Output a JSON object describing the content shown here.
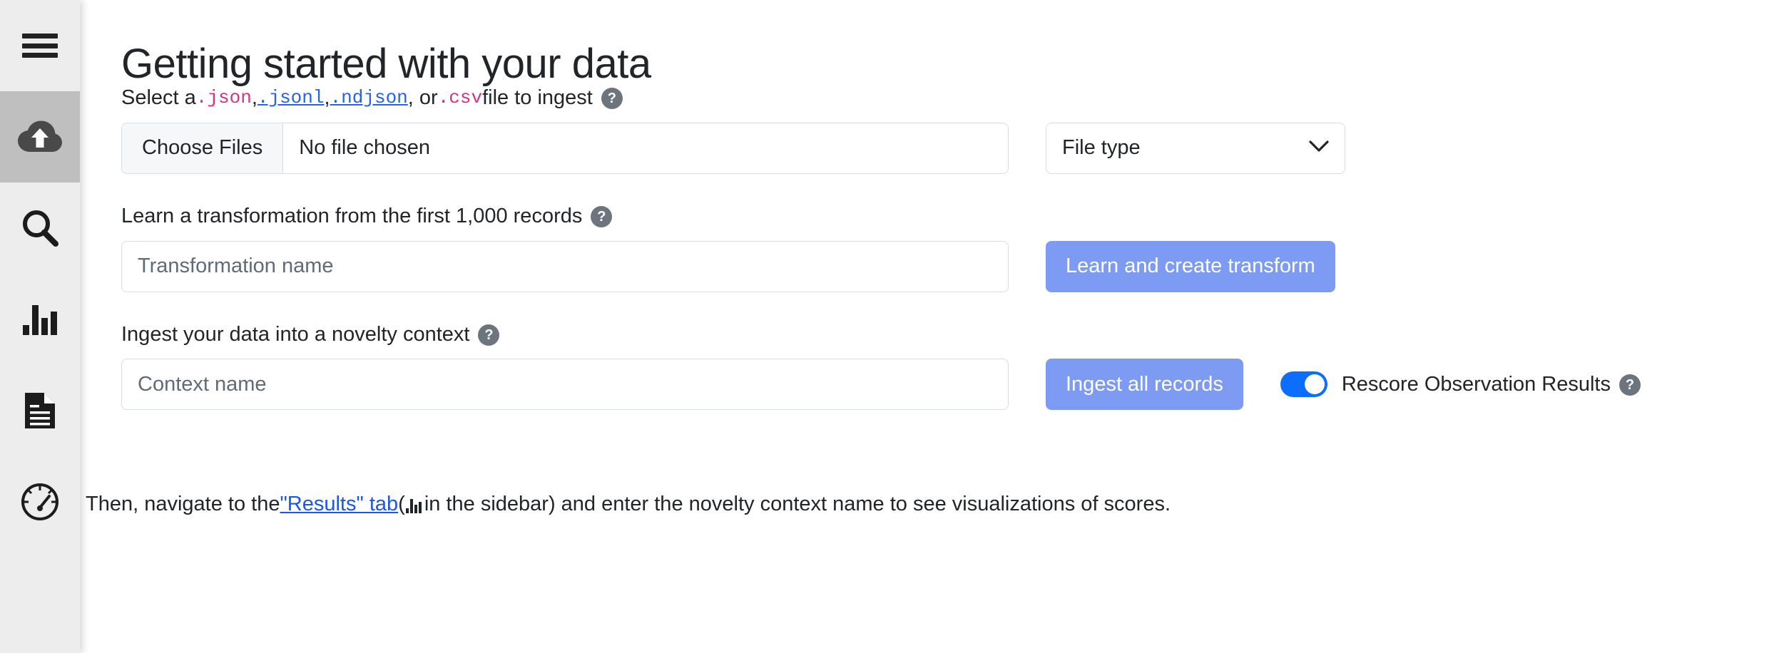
{
  "sidebar": {
    "items": [
      {
        "name": "menu",
        "icon": "hamburger-menu-icon",
        "selected": false
      },
      {
        "name": "ingest",
        "icon": "cloud-upload-icon",
        "selected": true
      },
      {
        "name": "search",
        "icon": "magnifier-icon",
        "selected": false
      },
      {
        "name": "results",
        "icon": "bar-chart-icon",
        "selected": false
      },
      {
        "name": "documents",
        "icon": "document-icon",
        "selected": false
      },
      {
        "name": "monitor",
        "icon": "gauge-icon",
        "selected": false
      }
    ]
  },
  "page": {
    "title": "Getting started with your data"
  },
  "file_section": {
    "label_prefix": "Select a ",
    "ext_json": ".json",
    "sep1": ", ",
    "ext_jsonl": ".jsonl",
    "sep2": ", ",
    "ext_ndjson": ".ndjson",
    "sep3": ", or ",
    "ext_csv": ".csv",
    "label_suffix": " file to ingest",
    "help": "?",
    "choose_files_label": "Choose Files",
    "file_chosen_text": "No file chosen",
    "file_type_value": "File type",
    "chevron": "chevron-down"
  },
  "transform_section": {
    "label": "Learn a transformation from the first 1,000 records",
    "help": "?",
    "input_placeholder": "Transformation name",
    "input_value": "",
    "button_label": "Learn and create transform"
  },
  "ingest_section": {
    "label": "Ingest your data into a novelty context",
    "help": "?",
    "input_placeholder": "Context name",
    "input_value": "",
    "button_label": "Ingest all records",
    "toggle_label": "Rescore Observation Results",
    "toggle_on": true,
    "toggle_help": "?"
  },
  "footer": {
    "text_before": "Then, navigate to the ",
    "link_text": "\"Results\" tab",
    "text_middle": " (",
    "text_after_icon": " in the sidebar) and enter the novelty context name to see visualizations of scores."
  },
  "colors": {
    "accent_blue": "#0d6efd",
    "button_blue": "#7d9bf2",
    "link_blue": "#1a56e8",
    "code_pink": "#d63384",
    "help_gray": "#6c757d",
    "sidebar_bg": "#ededed",
    "sidebar_selected": "#bfbfbf"
  }
}
